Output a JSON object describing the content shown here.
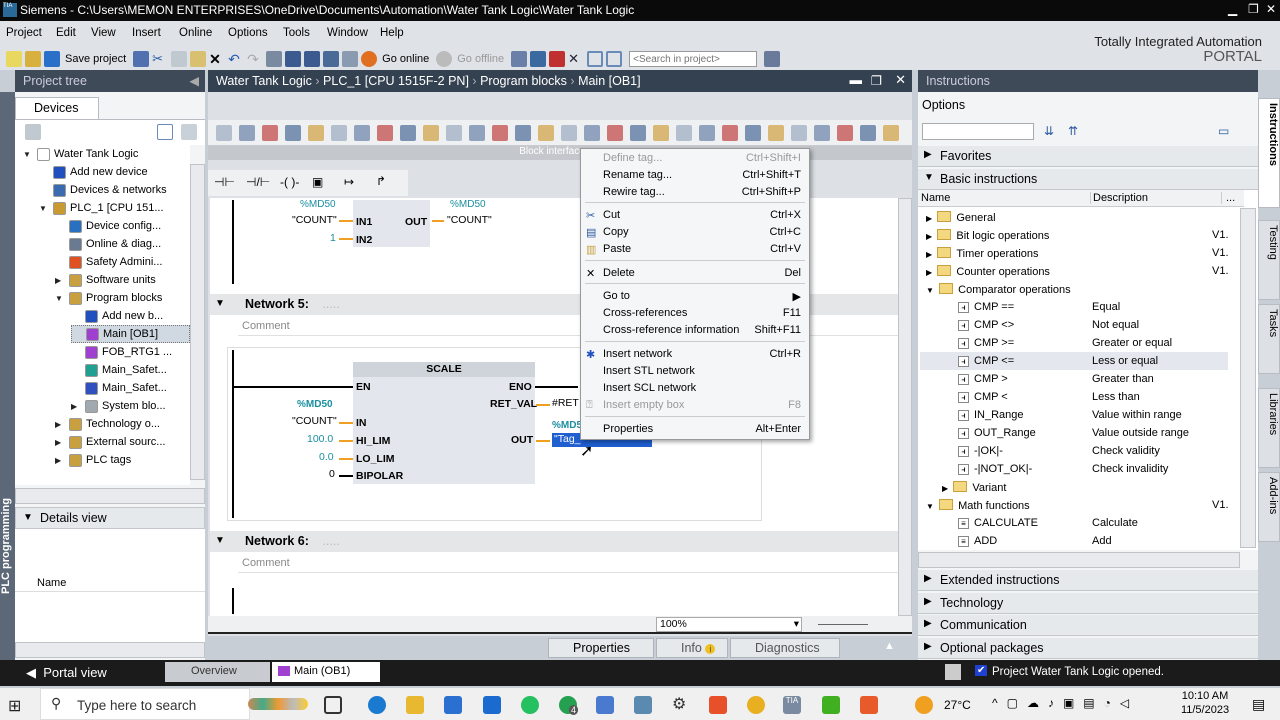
{
  "window": {
    "title": "Siemens  -  C:\\Users\\MEMON ENTERPRISES\\OneDrive\\Documents\\Automation\\Water Tank Logic\\Water Tank Logic"
  },
  "menu": [
    "Project",
    "Edit",
    "View",
    "Insert",
    "Online",
    "Options",
    "Tools",
    "Window",
    "Help"
  ],
  "toolbar": {
    "save_project": "Save project",
    "go_online": "Go online",
    "go_offline": "Go offline",
    "search_placeholder": "<Search in project>"
  },
  "brand": {
    "line1": "Totally Integrated Automation",
    "line2": "PORTAL"
  },
  "project_tree": {
    "title": "Project tree",
    "tab": "Devices",
    "side_label": "PLC programming",
    "items": [
      {
        "label": "Water Tank Logic",
        "level": 0,
        "expanded": true,
        "color": "#ffffff"
      },
      {
        "label": "Add new device",
        "level": 1,
        "color": "#2050c0"
      },
      {
        "label": "Devices & networks",
        "level": 1,
        "color": "#3a6ab0"
      },
      {
        "label": "PLC_1 [CPU 151...",
        "level": 1,
        "expanded": true,
        "color": "#c89a30"
      },
      {
        "label": "Device config...",
        "level": 2,
        "color": "#2a70c0"
      },
      {
        "label": "Online & diag...",
        "level": 2,
        "color": "#6a7a90"
      },
      {
        "label": "Safety Admini...",
        "level": 2,
        "color": "#e05020"
      },
      {
        "label": "Software units",
        "level": 2,
        "collapsed": true,
        "color": "#c8a040"
      },
      {
        "label": "Program blocks",
        "level": 2,
        "expanded": true,
        "color": "#c8a040"
      },
      {
        "label": "Add new b...",
        "level": 3,
        "color": "#2050c0"
      },
      {
        "label": "Main [OB1]",
        "level": 3,
        "selected": true,
        "color": "#a040d0"
      },
      {
        "label": "FOB_RTG1 ...",
        "level": 3,
        "color": "#a040d0"
      },
      {
        "label": "Main_Safet...",
        "level": 3,
        "color": "#20a090"
      },
      {
        "label": "Main_Safet...",
        "level": 3,
        "color": "#3050c0"
      },
      {
        "label": "System blo...",
        "level": 3,
        "collapsed": true,
        "color": "#a0a8b0"
      },
      {
        "label": "Technology o...",
        "level": 2,
        "collapsed": true,
        "color": "#c8a040"
      },
      {
        "label": "External sourc...",
        "level": 2,
        "collapsed": true,
        "color": "#c8a040"
      },
      {
        "label": "PLC tags",
        "level": 2,
        "collapsed": true,
        "color": "#c8a040"
      }
    ]
  },
  "details_view": {
    "title": "Details view",
    "column": "Name"
  },
  "editor": {
    "breadcrumb": [
      "Water Tank Logic",
      "PLC_1 [CPU 1515F-2 PN]",
      "Program blocks",
      "Main [OB1]"
    ],
    "block_interface": "Block interface",
    "network4": {
      "in1_addr": "%MD50",
      "in1_tag": "\"COUNT\"",
      "in1": "IN1",
      "in2_val": "1",
      "in2": "IN2",
      "out": "OUT",
      "out_addr": "%MD50",
      "out_tag": "\"COUNT\""
    },
    "network5": {
      "title": "Network 5:",
      "comment": "Comment",
      "box": "SCALE",
      "en": "EN",
      "eno": "ENO",
      "ret_val": "RET_VAL",
      "ret_tag": "#RET",
      "in_addr": "%MD50",
      "in_tag": "\"COUNT\"",
      "in": "IN",
      "hi_val": "100.0",
      "hi": "HI_LIM",
      "lo_val": "0.0",
      "lo": "LO_LIM",
      "bip_val": "0",
      "bip": "BIPOLAR",
      "out": "OUT",
      "out_addr": "%MD5",
      "out_tag": "\"Tag_"
    },
    "network6": {
      "title": "Network 6:",
      "comment": "Comment"
    },
    "zoom": "100%"
  },
  "context_menu": [
    {
      "label": "Define tag...",
      "shortcut": "Ctrl+Shift+I",
      "disabled": true
    },
    {
      "label": "Rename tag...",
      "shortcut": "Ctrl+Shift+T"
    },
    {
      "label": "Rewire tag...",
      "shortcut": "Ctrl+Shift+P"
    },
    {
      "label": "Cut",
      "shortcut": "Ctrl+X",
      "icon": "scissors"
    },
    {
      "label": "Copy",
      "shortcut": "Ctrl+C",
      "icon": "copy"
    },
    {
      "label": "Paste",
      "shortcut": "Ctrl+V",
      "icon": "paste"
    },
    {
      "label": "Delete",
      "shortcut": "Del",
      "icon": "x"
    },
    {
      "label": "Go to",
      "shortcut": "▶"
    },
    {
      "label": "Cross-references",
      "shortcut": "F11"
    },
    {
      "label": "Cross-reference information",
      "shortcut": "Shift+F11"
    },
    {
      "label": "Insert network",
      "shortcut": "Ctrl+R",
      "icon": "network"
    },
    {
      "label": "Insert STL network",
      "shortcut": ""
    },
    {
      "label": "Insert SCL network",
      "shortcut": ""
    },
    {
      "label": "Insert empty box",
      "shortcut": "F8",
      "disabled": true
    },
    {
      "label": "Properties",
      "shortcut": "Alt+Enter"
    }
  ],
  "inspector_tabs": {
    "properties": "Properties",
    "info": "Info",
    "diagnostics": "Diagnostics"
  },
  "instructions": {
    "title": "Instructions",
    "options": "Options",
    "favorites": "Favorites",
    "basic": "Basic instructions",
    "col_name": "Name",
    "col_desc": "Description",
    "col_more": "...",
    "rows": [
      {
        "name": "General",
        "desc": "",
        "ver": "",
        "type": "folder",
        "level": 0
      },
      {
        "name": "Bit logic operations",
        "desc": "",
        "ver": "V1.",
        "type": "folder",
        "level": 0
      },
      {
        "name": "Timer operations",
        "desc": "",
        "ver": "V1.",
        "type": "folder",
        "level": 0
      },
      {
        "name": "Counter operations",
        "desc": "",
        "ver": "V1.",
        "type": "folder",
        "level": 0
      },
      {
        "name": "Comparator operations",
        "desc": "",
        "ver": "",
        "type": "folder-open",
        "level": 0
      },
      {
        "name": "CMP ==",
        "desc": "Equal",
        "ver": "",
        "type": "cmp",
        "level": 1
      },
      {
        "name": "CMP <>",
        "desc": "Not equal",
        "ver": "",
        "type": "cmp",
        "level": 1
      },
      {
        "name": "CMP >=",
        "desc": "Greater or equal",
        "ver": "",
        "type": "cmp",
        "level": 1
      },
      {
        "name": "CMP <=",
        "desc": "Less or equal",
        "ver": "",
        "type": "cmp",
        "level": 1,
        "hover": true
      },
      {
        "name": "CMP >",
        "desc": "Greater than",
        "ver": "",
        "type": "cmp",
        "level": 1
      },
      {
        "name": "CMP <",
        "desc": "Less than",
        "ver": "",
        "type": "cmp",
        "level": 1
      },
      {
        "name": "IN_Range",
        "desc": "Value within range",
        "ver": "",
        "type": "cmp",
        "level": 1
      },
      {
        "name": "OUT_Range",
        "desc": "Value outside range",
        "ver": "",
        "type": "cmp",
        "level": 1
      },
      {
        "name": "-|OK|-",
        "desc": "Check validity",
        "ver": "",
        "type": "cmp",
        "level": 1
      },
      {
        "name": "-|NOT_OK|-",
        "desc": "Check invalidity",
        "ver": "",
        "type": "cmp",
        "level": 1
      },
      {
        "name": "Variant",
        "desc": "",
        "ver": "",
        "type": "folder",
        "level": 1
      },
      {
        "name": "Math functions",
        "desc": "",
        "ver": "V1.",
        "type": "folder-open",
        "level": 0
      },
      {
        "name": "CALCULATE",
        "desc": "Calculate",
        "ver": "",
        "type": "box",
        "level": 1
      },
      {
        "name": "ADD",
        "desc": "Add",
        "ver": "",
        "type": "box",
        "level": 1
      }
    ],
    "sections": [
      "Extended instructions",
      "Technology",
      "Communication",
      "Optional packages"
    ],
    "side_tabs": [
      "Instructions",
      "Testing",
      "Tasks",
      "Libraries",
      "Add-ins"
    ]
  },
  "status_bar": {
    "portal_view": "Portal view",
    "overview": "Overview",
    "main_tab": "Main (OB1)",
    "message": "Project Water Tank Logic opened."
  },
  "taskbar": {
    "search": "Type here to search",
    "weather": "27°C",
    "time": "10:10 AM",
    "date": "11/5/2023",
    "whatsapp_badge": "4"
  }
}
